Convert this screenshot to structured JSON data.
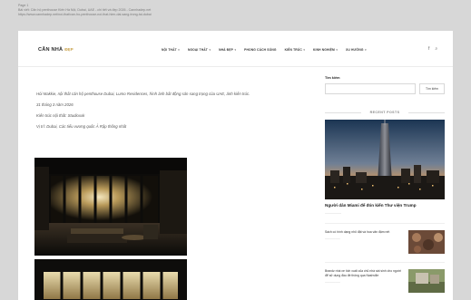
{
  "print_header": {
    "line1": "Page 1",
    "line2": "Bài viết: Căn hộ penthouse Kiến Hà Nội, Dubai, UAE - chi tiết và đẹp 2026 - Cannhadep.net",
    "line3": "https://www.cannhadep.net/noi-that/can-ho-penthouse-noi-that-hien-dai-sang-trong-tai-dubai"
  },
  "logo": {
    "main": "CĂN NHÀ",
    "accent": "ĐẸP"
  },
  "nav": {
    "items": [
      {
        "label": "NỘI THẤT",
        "has_caret": true
      },
      {
        "label": "NGOẠI THẤT",
        "has_caret": true
      },
      {
        "label": "NHÀ ĐẸP",
        "has_caret": true
      },
      {
        "label": "PHONG CÁCH SỐNG",
        "has_caret": false
      },
      {
        "label": "KIẾN TRÚC",
        "has_caret": true
      },
      {
        "label": "KINH NGHIỆM",
        "has_caret": true
      },
      {
        "label": "XU HƯỚNG",
        "has_caret": true
      }
    ],
    "facebook_glyph": "f",
    "search_glyph": "⌕"
  },
  "article": {
    "intro": "Hói Makkie, nội thất căn hộ penthouse Dubai, Lumo Residences, hình ảnh bất động sản sang trọng của UAE, ảnh kiến trúc.",
    "date": "31 tháng 3 năm 2026",
    "architect": "Kiến trúc nội thất: Studioxxk",
    "location": "Vị trí: Dubai, Các tiểu vương quốc Ả Rập thống nhất"
  },
  "sidebar": {
    "search_title": "Tìm kiếm",
    "search_placeholder": "",
    "search_button": "Tìm kiếm",
    "recent_title": "RECENT POSTS",
    "featured": {
      "title": "Người dân Miami để đón kiến Thư viện Trump",
      "date": "——————"
    },
    "posts": [
      {
        "title": "Sách có hình dạng nhỏ đặt và hoa văn đậm nét",
        "date": "——————"
      },
      {
        "title": "Brandz nhà xe tích xuất của chủ nhà sát sinh cho người để sử dụng đầu đề thông qua Nashville",
        "date": "——————"
      }
    ]
  },
  "colors": {
    "page_bg": "#ffffff",
    "surround_bg": "#d7d7d7",
    "logo_accent": "#c9a24a",
    "text_dark": "#222222",
    "text_body": "#555555"
  }
}
